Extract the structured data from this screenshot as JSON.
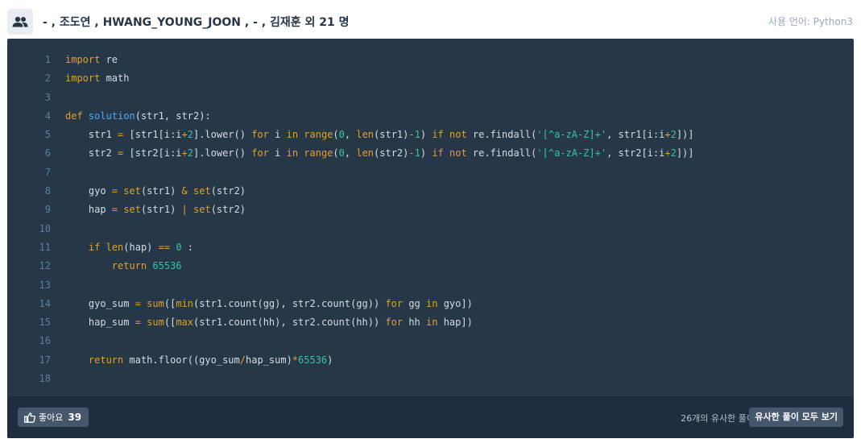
{
  "header": {
    "author_line": "- , 조도연 , HWANG_YOUNG_JOON , - , 김재훈 외 21 명",
    "language_label": "사용 언어: Python3",
    "avatar_icon": "users-icon"
  },
  "code": {
    "lines": [
      {
        "n": "1",
        "tokens": [
          [
            "kw",
            "import"
          ],
          [
            "id",
            " re"
          ]
        ]
      },
      {
        "n": "2",
        "tokens": [
          [
            "kw",
            "import"
          ],
          [
            "id",
            " math"
          ]
        ]
      },
      {
        "n": "3",
        "tokens": []
      },
      {
        "n": "4",
        "tokens": [
          [
            "kw",
            "def"
          ],
          [
            "id",
            " "
          ],
          [
            "fn",
            "solution"
          ],
          [
            "id",
            "(str1, str2):"
          ]
        ]
      },
      {
        "n": "5",
        "tokens": [
          [
            "id",
            "    str1 "
          ],
          [
            "op",
            "="
          ],
          [
            "id",
            " [str1[i:i"
          ],
          [
            "op",
            "+"
          ],
          [
            "num",
            "2"
          ],
          [
            "id",
            "].lower() "
          ],
          [
            "kw",
            "for"
          ],
          [
            "id",
            " i "
          ],
          [
            "kw",
            "in"
          ],
          [
            "id",
            " "
          ],
          [
            "bi",
            "range"
          ],
          [
            "id",
            "("
          ],
          [
            "num",
            "0"
          ],
          [
            "id",
            ", "
          ],
          [
            "bi",
            "len"
          ],
          [
            "id",
            "(str1)"
          ],
          [
            "op",
            "-"
          ],
          [
            "num",
            "1"
          ],
          [
            "id",
            ") "
          ],
          [
            "kw",
            "if"
          ],
          [
            "id",
            " "
          ],
          [
            "kw",
            "not"
          ],
          [
            "id",
            " re.findall("
          ],
          [
            "str",
            "'[^a-zA-Z]+'"
          ],
          [
            "id",
            ", str1[i:i"
          ],
          [
            "op",
            "+"
          ],
          [
            "num",
            "2"
          ],
          [
            "id",
            "])]"
          ]
        ]
      },
      {
        "n": "6",
        "tokens": [
          [
            "id",
            "    str2 "
          ],
          [
            "op",
            "="
          ],
          [
            "id",
            " [str2[i:i"
          ],
          [
            "op",
            "+"
          ],
          [
            "num",
            "2"
          ],
          [
            "id",
            "].lower() "
          ],
          [
            "kw",
            "for"
          ],
          [
            "id",
            " i "
          ],
          [
            "kw",
            "in"
          ],
          [
            "id",
            " "
          ],
          [
            "bi",
            "range"
          ],
          [
            "id",
            "("
          ],
          [
            "num",
            "0"
          ],
          [
            "id",
            ", "
          ],
          [
            "bi",
            "len"
          ],
          [
            "id",
            "(str2)"
          ],
          [
            "op",
            "-"
          ],
          [
            "num",
            "1"
          ],
          [
            "id",
            ") "
          ],
          [
            "kw",
            "if"
          ],
          [
            "id",
            " "
          ],
          [
            "kw",
            "not"
          ],
          [
            "id",
            " re.findall("
          ],
          [
            "str",
            "'[^a-zA-Z]+'"
          ],
          [
            "id",
            ", str2[i:i"
          ],
          [
            "op",
            "+"
          ],
          [
            "num",
            "2"
          ],
          [
            "id",
            "])]"
          ]
        ]
      },
      {
        "n": "7",
        "tokens": []
      },
      {
        "n": "8",
        "tokens": [
          [
            "id",
            "    gyo "
          ],
          [
            "op",
            "="
          ],
          [
            "id",
            " "
          ],
          [
            "bi",
            "set"
          ],
          [
            "id",
            "(str1) "
          ],
          [
            "op",
            "&"
          ],
          [
            "id",
            " "
          ],
          [
            "bi",
            "set"
          ],
          [
            "id",
            "(str2)"
          ]
        ]
      },
      {
        "n": "9",
        "tokens": [
          [
            "id",
            "    hap "
          ],
          [
            "op",
            "="
          ],
          [
            "id",
            " "
          ],
          [
            "bi",
            "set"
          ],
          [
            "id",
            "(str1) "
          ],
          [
            "op",
            "|"
          ],
          [
            "id",
            " "
          ],
          [
            "bi",
            "set"
          ],
          [
            "id",
            "(str2)"
          ]
        ]
      },
      {
        "n": "10",
        "tokens": []
      },
      {
        "n": "11",
        "tokens": [
          [
            "id",
            "    "
          ],
          [
            "kw",
            "if"
          ],
          [
            "id",
            " "
          ],
          [
            "bi",
            "len"
          ],
          [
            "id",
            "(hap) "
          ],
          [
            "op",
            "=="
          ],
          [
            "id",
            " "
          ],
          [
            "num",
            "0"
          ],
          [
            "id",
            " :"
          ]
        ]
      },
      {
        "n": "12",
        "tokens": [
          [
            "id",
            "        "
          ],
          [
            "kw",
            "return"
          ],
          [
            "id",
            " "
          ],
          [
            "num",
            "65536"
          ]
        ]
      },
      {
        "n": "13",
        "tokens": []
      },
      {
        "n": "14",
        "tokens": [
          [
            "id",
            "    gyo_sum "
          ],
          [
            "op",
            "="
          ],
          [
            "id",
            " "
          ],
          [
            "bi",
            "sum"
          ],
          [
            "id",
            "(["
          ],
          [
            "bi",
            "min"
          ],
          [
            "id",
            "(str1.count(gg), str2.count(gg)) "
          ],
          [
            "kw",
            "for"
          ],
          [
            "id",
            " gg "
          ],
          [
            "kw",
            "in"
          ],
          [
            "id",
            " gyo])"
          ]
        ]
      },
      {
        "n": "15",
        "tokens": [
          [
            "id",
            "    hap_sum "
          ],
          [
            "op",
            "="
          ],
          [
            "id",
            " "
          ],
          [
            "bi",
            "sum"
          ],
          [
            "id",
            "(["
          ],
          [
            "bi",
            "max"
          ],
          [
            "id",
            "(str1.count(hh), str2.count(hh)) "
          ],
          [
            "kw",
            "for"
          ],
          [
            "id",
            " hh "
          ],
          [
            "kw",
            "in"
          ],
          [
            "id",
            " hap])"
          ]
        ]
      },
      {
        "n": "16",
        "tokens": []
      },
      {
        "n": "17",
        "tokens": [
          [
            "id",
            "    "
          ],
          [
            "kw",
            "return"
          ],
          [
            "id",
            " math.floor((gyo_sum"
          ],
          [
            "op",
            "/"
          ],
          [
            "id",
            "hap_sum)"
          ],
          [
            "op",
            "*"
          ],
          [
            "num",
            "65536"
          ],
          [
            "id",
            ")"
          ]
        ]
      },
      {
        "n": "18",
        "tokens": []
      }
    ]
  },
  "footer": {
    "like_label": "좋아요",
    "like_count": "39",
    "like_icon": "thumbs-up-icon",
    "similar_count_label": "26개의 유사한 풀이",
    "similar_button_label": "유사한 풀이 모두 보기"
  }
}
